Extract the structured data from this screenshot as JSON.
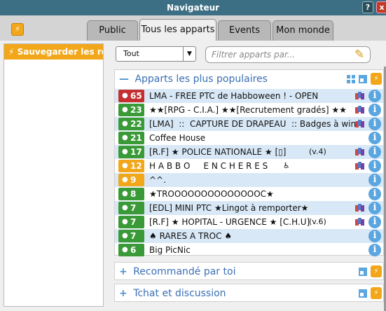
{
  "window": {
    "title": "Navigateur",
    "help_label": "?",
    "close_label": "x"
  },
  "tabs": [
    {
      "label": "Public",
      "active": false
    },
    {
      "label": "Tous les apparts",
      "active": true
    },
    {
      "label": "Events",
      "active": false
    },
    {
      "label": "Mon monde",
      "active": false
    }
  ],
  "sidebar": {
    "save_label": "Sauvegarder les recherches"
  },
  "filter": {
    "selected": "Tout",
    "search_placeholder": "Filtrer apparts par..."
  },
  "sections": {
    "popular": {
      "title": "Apparts les plus populaires",
      "expanded": true
    },
    "recommended": {
      "title": "Recommandé par toi",
      "expanded": false
    },
    "chat": {
      "title": "Tchat et discussion",
      "expanded": false
    }
  },
  "rooms": [
    {
      "count": "65",
      "color": "red",
      "name": "LMA - FREE PTC de Habboween ! - OPEN",
      "extra": "",
      "rooms_icon": true
    },
    {
      "count": "23",
      "color": "green",
      "name": "★★[RPG - C.I.A.] ★★[Recrutement gradés] ★★",
      "extra": "",
      "rooms_icon": true
    },
    {
      "count": "22",
      "color": "green",
      "name": "[LMA]  ::  CAPTURE DE DRAPEAU  :: Badges à win",
      "extra": "",
      "rooms_icon": true
    },
    {
      "count": "21",
      "color": "green",
      "name": "Coffee House",
      "extra": "",
      "rooms_icon": false
    },
    {
      "count": "17",
      "color": "green",
      "name": "[R.F] ★ POLICE NATIONALE ★ [▯]",
      "extra": "(v.4)",
      "rooms_icon": true
    },
    {
      "count": "12",
      "color": "orange",
      "name": "H A B B O     E N C H E R E S",
      "extra": "♿",
      "rooms_icon": true
    },
    {
      "count": "9",
      "color": "orange",
      "name": "^^.",
      "extra": "",
      "rooms_icon": false
    },
    {
      "count": "8",
      "color": "green",
      "name": "★TROOOOOOOOOOOOOOC★",
      "extra": "",
      "rooms_icon": false
    },
    {
      "count": "7",
      "color": "green",
      "name": "[EDL] MINI PTC ★Lingot à remporter★",
      "extra": "",
      "rooms_icon": true
    },
    {
      "count": "7",
      "color": "green",
      "name": "[R.F] ★ HOPITAL - URGENCE ★ [C.H.U]",
      "extra": "(v.6)",
      "rooms_icon": true
    },
    {
      "count": "7",
      "color": "green",
      "name": "♠ RARES A TROC ♠",
      "extra": "",
      "rooms_icon": false
    },
    {
      "count": "6",
      "color": "green",
      "name": "Big PicNic",
      "extra": "",
      "rooms_icon": false
    }
  ],
  "icons": {
    "bolt": "⚡",
    "person": "👤",
    "info": "i",
    "pencil": "✎"
  }
}
